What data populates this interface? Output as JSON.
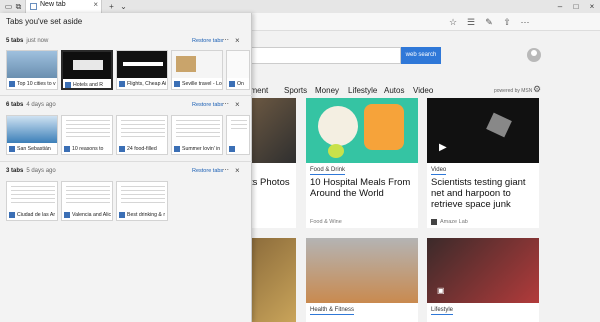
{
  "browser": {
    "tab_label": "New tab"
  },
  "page": {
    "search_button": "web search",
    "nav": [
      "nment",
      "Sports",
      "Money",
      "Lifestyle",
      "Autos",
      "Video"
    ],
    "powered_by": "powered by MSN",
    "cards": [
      {
        "category": "",
        "title": "ts Photos",
        "source": ""
      },
      {
        "category": "Food & Drink",
        "title": "10 Hospital Meals From Around the World",
        "source": "Food & Wine"
      },
      {
        "category": "Video",
        "title": "Scientists testing giant net and harpoon to retrieve space junk",
        "source": "Amaze Lab"
      },
      {
        "category": "Health & Fitness",
        "title": "",
        "source": ""
      },
      {
        "category": "Lifestyle",
        "title": "",
        "source": ""
      }
    ]
  },
  "aside": {
    "title": "Tabs you've set aside",
    "restore_label": "Restore tabs",
    "groups": [
      {
        "count": "5 tabs",
        "ago": "just now",
        "tabs": [
          "Top 10 cities to v",
          "Hotels and R",
          "Flights, Cheap Ai",
          "Seville travel - Lo",
          "On"
        ]
      },
      {
        "count": "6 tabs",
        "ago": "4 days ago",
        "tabs": [
          "San Sebastián",
          "10 reasons to",
          "24 food-filled",
          "Summer lovin' in",
          ""
        ]
      },
      {
        "count": "3 tabs",
        "ago": "5 days ago",
        "tabs": [
          "Ciudad de las Ar",
          "Valencia and Alic",
          "Best drinking & r"
        ]
      }
    ]
  },
  "colors": {
    "accent": "#2f78d8",
    "panel_bg": "#f3f3f3",
    "page_bg": "#f2f2f2"
  }
}
